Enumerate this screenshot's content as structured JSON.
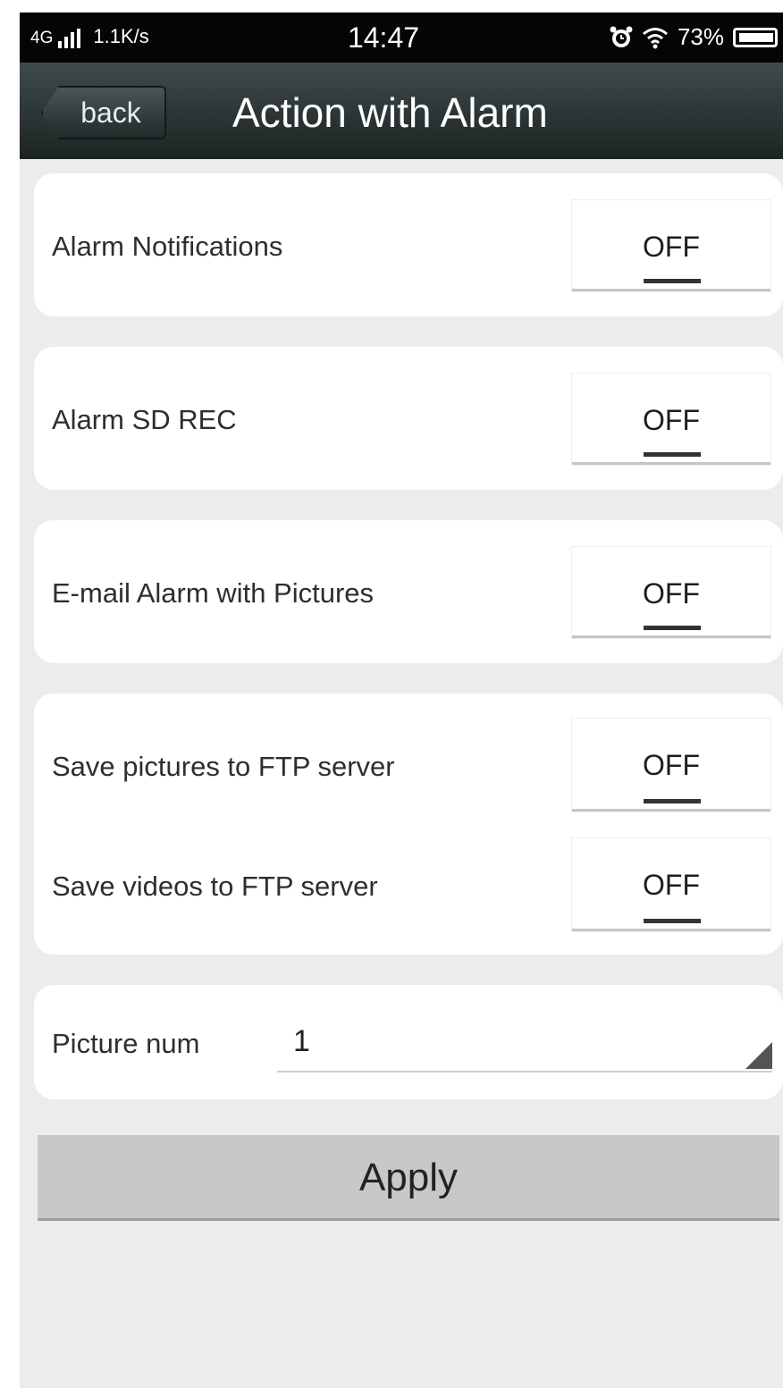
{
  "status": {
    "network": "4G",
    "speed": "1.1K/s",
    "time": "14:47",
    "battery": "73%"
  },
  "nav": {
    "back_label": "back",
    "title": "Action with Alarm"
  },
  "settings": [
    {
      "label": "Alarm Notifications",
      "value": "OFF"
    },
    {
      "label": "Alarm SD REC",
      "value": "OFF"
    },
    {
      "label": "E-mail Alarm with Pictures",
      "value": "OFF"
    },
    {
      "label": "Save pictures to FTP server",
      "value": "OFF"
    },
    {
      "label": "Save videos to FTP server",
      "value": "OFF"
    }
  ],
  "picture_num": {
    "label": "Picture num",
    "value": "1"
  },
  "apply_label": "Apply"
}
